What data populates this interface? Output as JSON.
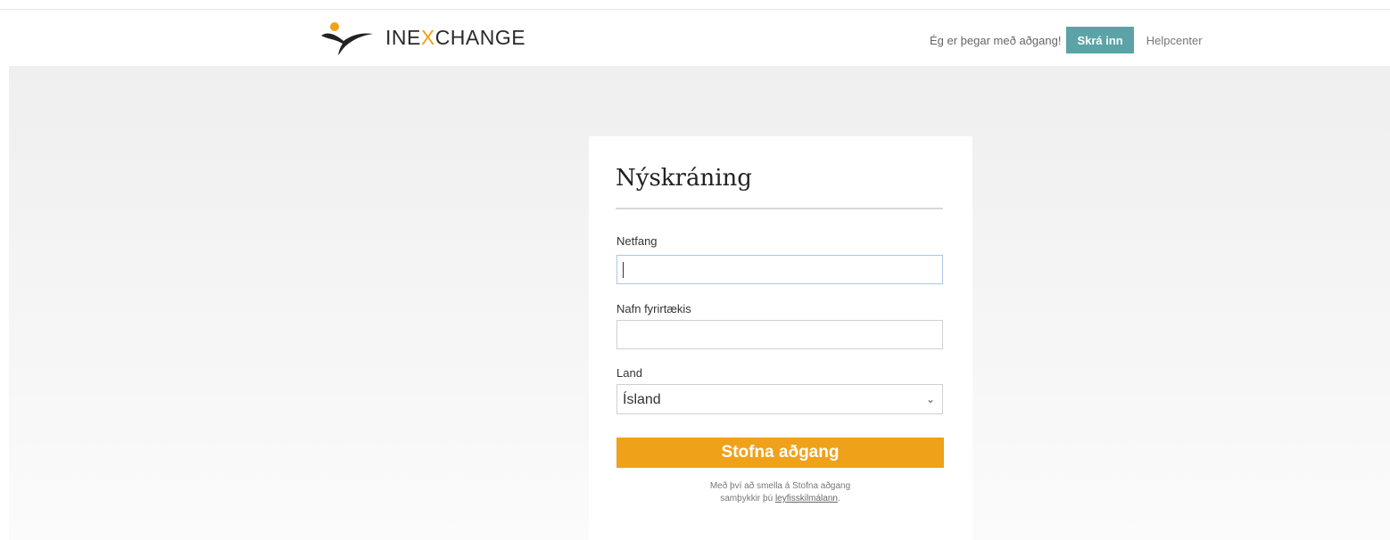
{
  "header": {
    "logo_text_before": "INE",
    "logo_text_x": "X",
    "logo_text_after": "CHANGE",
    "already_text": "Ég er þegar með aðgang!",
    "login_label": "Skrá inn",
    "help_label": "Helpcenter"
  },
  "form": {
    "title": "Nýskráning",
    "email_label": "Netfang",
    "email_value": "",
    "company_label": "Nafn fyrirtækis",
    "company_value": "",
    "country_label": "Land",
    "country_selected": "Ísland",
    "submit_label": "Stofna aðgang",
    "terms_line1": "Með því að smella á Stofna aðgang",
    "terms_line2_prefix": "samþykkir þú ",
    "terms_link": "leyfisskilmálann",
    "terms_suffix": "."
  },
  "colors": {
    "accent_orange": "#f0a11a",
    "login_teal": "#5ba3a7"
  },
  "icons": {
    "logo": "inexchange-bird-logo",
    "select_chevron": "chevron-down-icon"
  }
}
